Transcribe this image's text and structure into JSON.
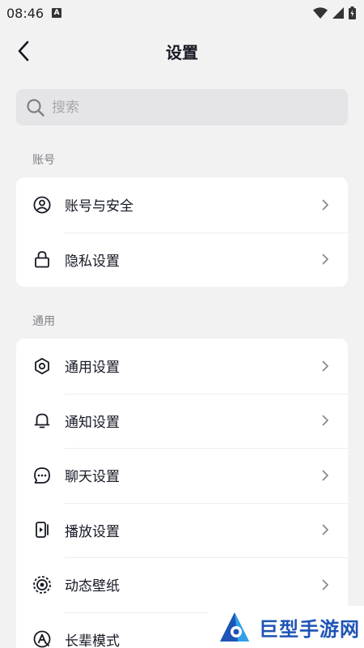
{
  "status_bar": {
    "time": "08:46",
    "notification_icon": "A"
  },
  "header": {
    "title": "设置"
  },
  "search": {
    "placeholder": "搜索"
  },
  "sections": [
    {
      "label": "账号",
      "items": [
        {
          "label": "账号与安全",
          "icon": "user-circle-icon"
        },
        {
          "label": "隐私设置",
          "icon": "lock-icon"
        }
      ]
    },
    {
      "label": "通用",
      "items": [
        {
          "label": "通用设置",
          "icon": "gear-icon"
        },
        {
          "label": "通知设置",
          "icon": "bell-icon"
        },
        {
          "label": "聊天设置",
          "icon": "chat-bubble-icon"
        },
        {
          "label": "播放设置",
          "icon": "play-phone-icon"
        },
        {
          "label": "动态壁纸",
          "icon": "wallpaper-icon"
        },
        {
          "label": "长辈模式",
          "icon": "elder-mode-icon"
        }
      ]
    }
  ],
  "watermark": {
    "text": "巨型手游网"
  },
  "colors": {
    "background": "#f2f2f2",
    "card": "#ffffff",
    "text": "#161823",
    "watermark": "#1e54b6"
  }
}
